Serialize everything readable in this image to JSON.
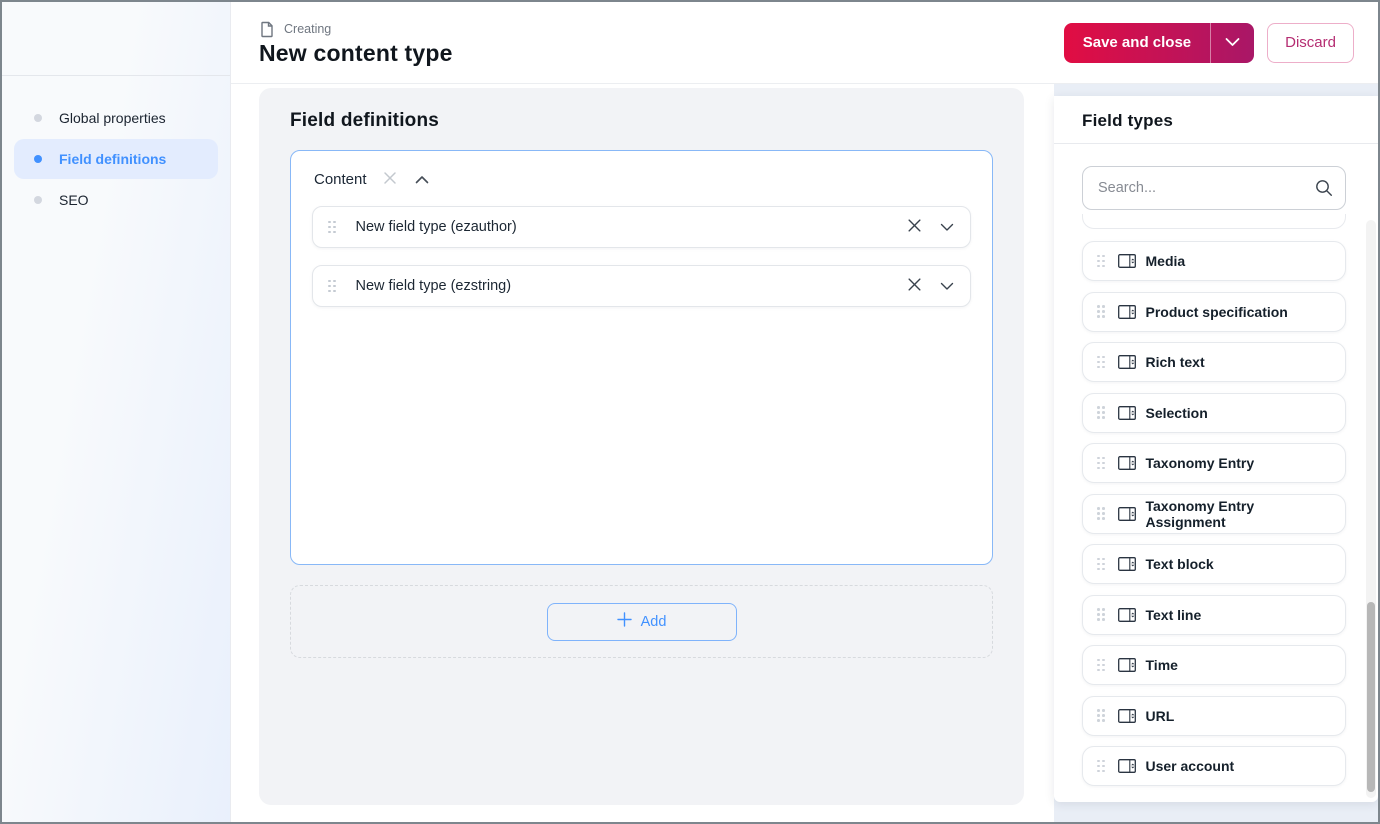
{
  "header": {
    "breadcrumb_label": "Creating",
    "title": "New content type",
    "save_button": "Save and close",
    "discard_button": "Discard"
  },
  "sidebar": {
    "items": [
      {
        "label": "Global properties",
        "active": false
      },
      {
        "label": "Field definitions",
        "active": true
      },
      {
        "label": "SEO",
        "active": false
      }
    ]
  },
  "main": {
    "title": "Field definitions",
    "group": {
      "label": "Content",
      "fields": [
        "New field type (ezauthor)",
        "New field type (ezstring)"
      ]
    },
    "add_button": "Add"
  },
  "field_types_panel": {
    "title": "Field types",
    "search_placeholder": "Search...",
    "items": [
      "Media",
      "Product specification",
      "Rich text",
      "Selection",
      "Taxonomy Entry",
      "Taxonomy Entry Assignment",
      "Text block",
      "Text line",
      "Time",
      "URL",
      "User account"
    ]
  },
  "colors": {
    "accent_blue": "#4191ff",
    "primary_gradient_start": "#e10d43",
    "primary_gradient_end": "#a91767",
    "discard_text": "#b52d72",
    "panel_bg": "#f2f3f6",
    "group_border": "#88b8f7",
    "text_dark": "#10161d"
  }
}
